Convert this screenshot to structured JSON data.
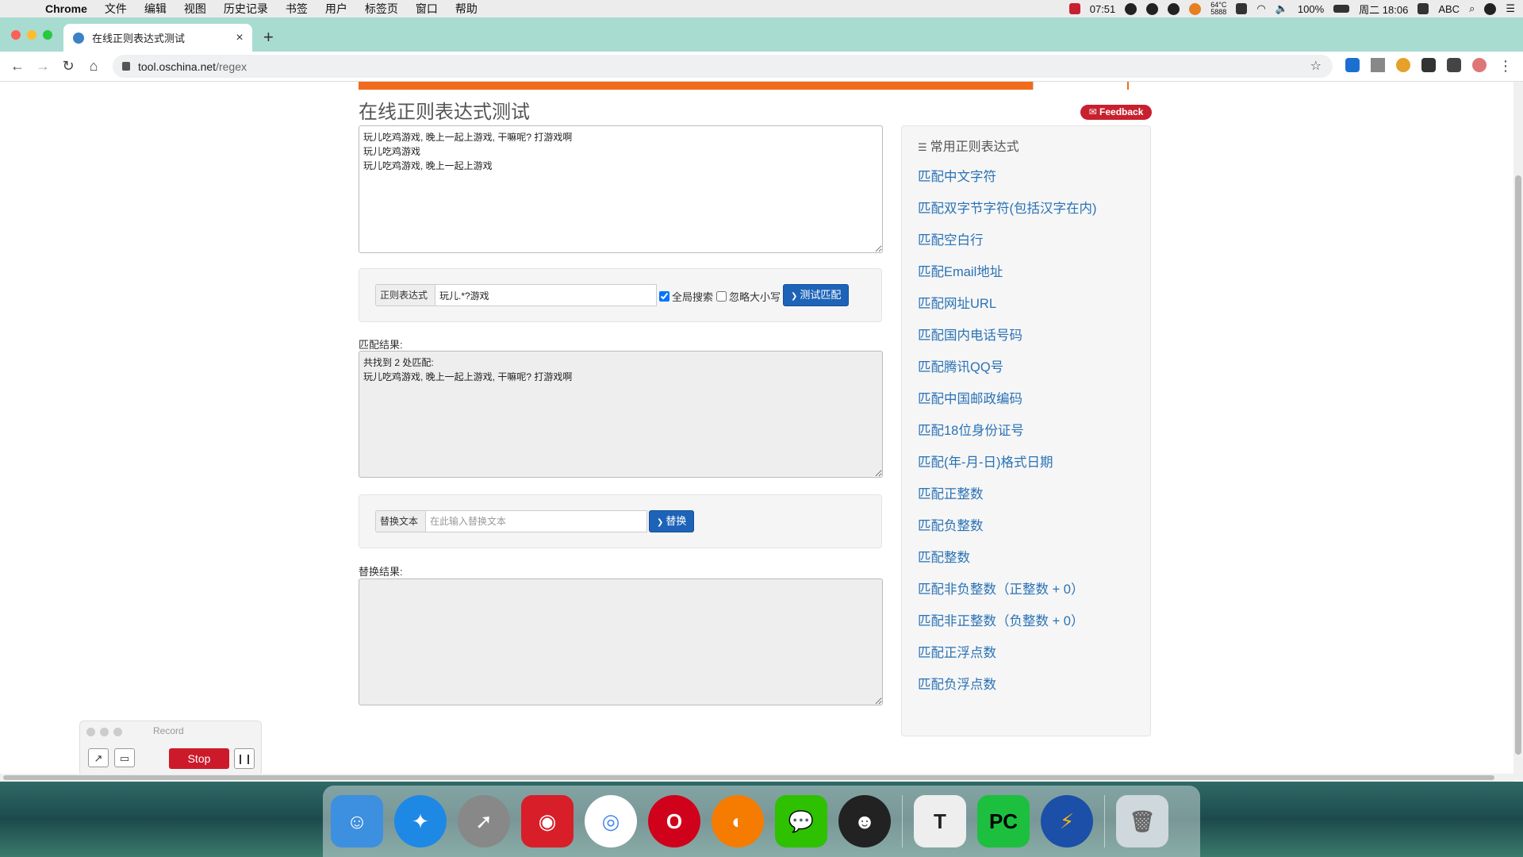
{
  "menubar": {
    "app": "Chrome",
    "items": [
      "文件",
      "编辑",
      "视图",
      "历史记录",
      "书签",
      "用户",
      "标签页",
      "窗口",
      "帮助"
    ],
    "time_left": "07:51",
    "temp": "64°C",
    "rpm": "5888",
    "battery": "100%",
    "input": "ABC",
    "clock": "周二 18:06"
  },
  "tab": {
    "title": "在线正则表达式测试",
    "close": "×",
    "new": "+"
  },
  "omnibox": {
    "host": "tool.oschina.net",
    "path": "/regex"
  },
  "page": {
    "title": "在线正则表达式测试",
    "feedback": "✉ Feedback",
    "source_text": "玩儿吃鸡游戏, 晚上一起上游戏, 干嘛呢? 打游戏啊\n玩儿吃鸡游戏\n玩儿吃鸡游戏, 晚上一起上游戏",
    "regex": {
      "label": "正则表达式",
      "value": "玩儿.*?游戏",
      "global_label": "全局搜索",
      "global_checked": true,
      "ignorecase_label": "忽略大小写",
      "ignorecase_checked": false,
      "test_button": "测试匹配"
    },
    "match": {
      "label": "匹配结果:",
      "text": "共找到 2 处匹配:\n玩儿吃鸡游戏, 晚上一起上游戏, 干嘛呢? 打游戏啊"
    },
    "replace": {
      "label": "替换文本",
      "placeholder": "在此输入替换文本",
      "button": "替换",
      "result_label": "替换结果:",
      "result_text": ""
    },
    "sidebar": {
      "title": "常用正则表达式",
      "items": [
        "匹配中文字符",
        "匹配双字节字符(包括汉字在内)",
        "匹配空白行",
        "匹配Email地址",
        "匹配网址URL",
        "匹配国内电话号码",
        "匹配腾讯QQ号",
        "匹配中国邮政编码",
        "匹配18位身份证号",
        "匹配(年-月-日)格式日期",
        "匹配正整数",
        "匹配负整数",
        "匹配整数",
        "匹配非负整数（正整数 + 0）",
        "匹配非正整数（负整数 + 0）",
        "匹配正浮点数",
        "匹配负浮点数"
      ]
    }
  },
  "recorder": {
    "title": "Record",
    "stop": "Stop"
  },
  "dock": {
    "apps": [
      "Finder",
      "Safari",
      "Launchpad",
      "NetEase Music",
      "Chrome",
      "Opera",
      "Firefox",
      "WeChat",
      "QQ",
      "Typora",
      "PyCharm",
      "Reeder",
      "Trash"
    ]
  },
  "colors": {
    "tabbar": "#a8dcd1",
    "link": "#2a72b5",
    "button": "#1d63b8",
    "feedback": "#c8202f",
    "stop": "#cc1a2b",
    "banner": "#f26a1b"
  }
}
